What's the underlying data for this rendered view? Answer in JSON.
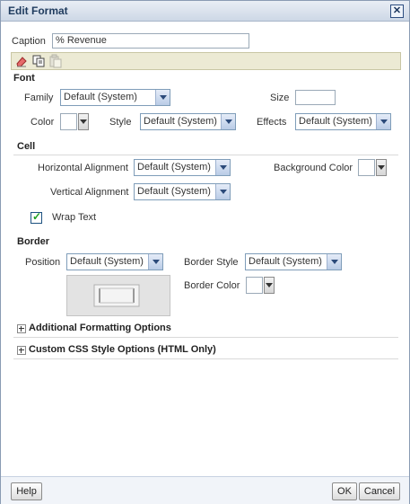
{
  "dialog": {
    "title": "Edit Format"
  },
  "caption": {
    "label": "Caption",
    "value": "% Revenue"
  },
  "font": {
    "section": "Font",
    "family_label": "Family",
    "family_value": "Default (System)",
    "size_label": "Size",
    "size_value": "",
    "color_label": "Color",
    "style_label": "Style",
    "style_value": "Default (System)",
    "effects_label": "Effects",
    "effects_value": "Default (System)"
  },
  "cell": {
    "section": "Cell",
    "halign_label": "Horizontal Alignment",
    "halign_value": "Default (System)",
    "bg_label": "Background Color",
    "valign_label": "Vertical Alignment",
    "valign_value": "Default (System)",
    "wrap_label": "Wrap Text",
    "wrap_checked": true
  },
  "border": {
    "section": "Border",
    "position_label": "Position",
    "position_value": "Default (System)",
    "style_label": "Border Style",
    "style_value": "Default (System)",
    "color_label": "Border Color"
  },
  "expanders": {
    "additional": "Additional Formatting Options",
    "css": "Custom CSS Style Options (HTML Only)"
  },
  "footer": {
    "help": "Help",
    "ok": "OK",
    "cancel": "Cancel"
  },
  "icons": [
    "eraser-icon",
    "copy-icon",
    "paste-icon",
    "close-icon",
    "checkmark-icon",
    "expand-plus-icon"
  ],
  "colors": {
    "titlebar": "#cdd8e6",
    "toolbar": "#ecead4",
    "select_border": "#7f9db9"
  }
}
